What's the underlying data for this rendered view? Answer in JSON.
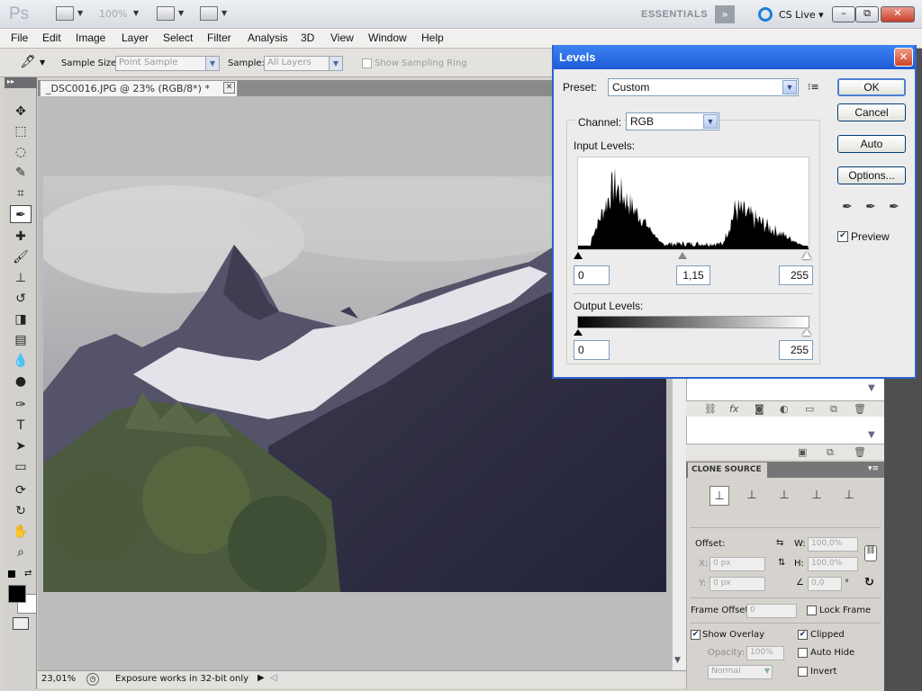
{
  "appbar": {
    "logo": "Ps",
    "zoom": "100%",
    "workspace": "ESSENTIALS",
    "more": "»",
    "cs_live": "CS Live",
    "minimize": "–",
    "restore": "⧉",
    "close": "✕"
  },
  "menu": [
    "File",
    "Edit",
    "Image",
    "Layer",
    "Select",
    "Filter",
    "Analysis",
    "3D",
    "View",
    "Window",
    "Help"
  ],
  "options": {
    "sample_size_label": "Sample Size:",
    "sample_size_value": "Point Sample",
    "sample_label": "Sample:",
    "sample_value": "All Layers",
    "sampling_ring": "Show Sampling Ring"
  },
  "document": {
    "tab_title": "_DSC0016.JPG @ 23% (RGB/8*) *",
    "zoom": "23,01%",
    "status": "Exposure works in 32-bit only"
  },
  "levels": {
    "title": "Levels",
    "preset_label": "Preset:",
    "preset_value": "Custom",
    "channel_label": "Channel:",
    "channel_value": "RGB",
    "input_label": "Input Levels:",
    "input_black": "0",
    "input_gamma": "1,15",
    "input_white": "255",
    "output_label": "Output Levels:",
    "output_black": "0",
    "output_white": "255",
    "ok": "OK",
    "cancel": "Cancel",
    "auto": "Auto",
    "options": "Options...",
    "preview": "Preview",
    "preview_checked": true
  },
  "clone_source": {
    "tab": "CLONE SOURCE",
    "offset_label": "Offset:",
    "x_label": "X:",
    "x_value": "0 px",
    "y_label": "Y:",
    "y_value": "0 px",
    "w_label": "W:",
    "w_value": "100,0%",
    "h_label": "H:",
    "h_value": "100,0%",
    "angle_value": "0,0",
    "angle_unit": "°",
    "frame_offset_label": "Frame Offset:",
    "frame_offset_value": "0",
    "lock_frame": "Lock Frame",
    "show_overlay": "Show Overlay",
    "clipped": "Clipped",
    "opacity_label": "Opacity:",
    "opacity_value": "100%",
    "auto_hide": "Auto Hide",
    "blend_mode": "Normal",
    "invert": "Invert"
  },
  "colors": {
    "title_blue": "#2d63d0",
    "foreground": "#000000",
    "background": "#ffffff"
  }
}
